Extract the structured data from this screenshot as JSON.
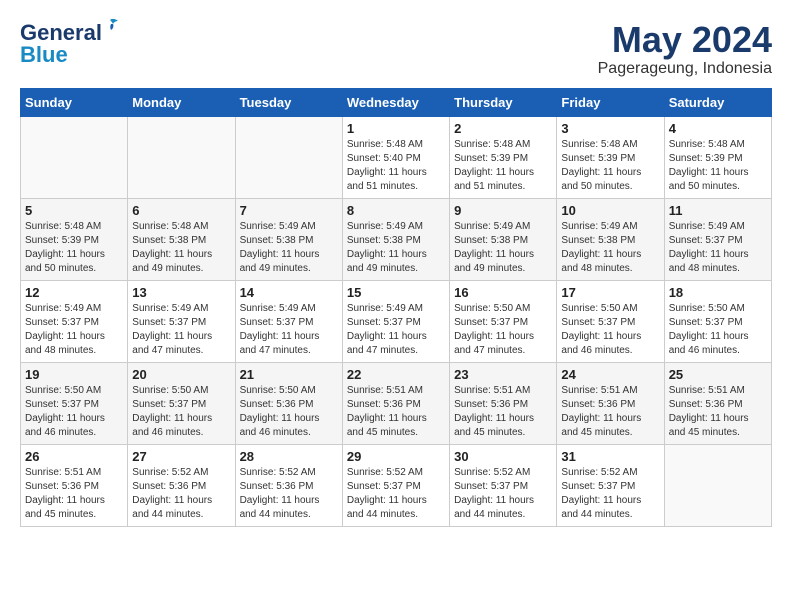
{
  "logo": {
    "text_general": "General",
    "text_blue": "Blue"
  },
  "title": {
    "month_year": "May 2024",
    "location": "Pagerageung, Indonesia"
  },
  "days_header": [
    "Sunday",
    "Monday",
    "Tuesday",
    "Wednesday",
    "Thursday",
    "Friday",
    "Saturday"
  ],
  "weeks": [
    {
      "days": [
        {
          "num": "",
          "info": ""
        },
        {
          "num": "",
          "info": ""
        },
        {
          "num": "",
          "info": ""
        },
        {
          "num": "1",
          "info": "Sunrise: 5:48 AM\nSunset: 5:40 PM\nDaylight: 11 hours\nand 51 minutes."
        },
        {
          "num": "2",
          "info": "Sunrise: 5:48 AM\nSunset: 5:39 PM\nDaylight: 11 hours\nand 51 minutes."
        },
        {
          "num": "3",
          "info": "Sunrise: 5:48 AM\nSunset: 5:39 PM\nDaylight: 11 hours\nand 50 minutes."
        },
        {
          "num": "4",
          "info": "Sunrise: 5:48 AM\nSunset: 5:39 PM\nDaylight: 11 hours\nand 50 minutes."
        }
      ]
    },
    {
      "days": [
        {
          "num": "5",
          "info": "Sunrise: 5:48 AM\nSunset: 5:39 PM\nDaylight: 11 hours\nand 50 minutes."
        },
        {
          "num": "6",
          "info": "Sunrise: 5:48 AM\nSunset: 5:38 PM\nDaylight: 11 hours\nand 49 minutes."
        },
        {
          "num": "7",
          "info": "Sunrise: 5:49 AM\nSunset: 5:38 PM\nDaylight: 11 hours\nand 49 minutes."
        },
        {
          "num": "8",
          "info": "Sunrise: 5:49 AM\nSunset: 5:38 PM\nDaylight: 11 hours\nand 49 minutes."
        },
        {
          "num": "9",
          "info": "Sunrise: 5:49 AM\nSunset: 5:38 PM\nDaylight: 11 hours\nand 49 minutes."
        },
        {
          "num": "10",
          "info": "Sunrise: 5:49 AM\nSunset: 5:38 PM\nDaylight: 11 hours\nand 48 minutes."
        },
        {
          "num": "11",
          "info": "Sunrise: 5:49 AM\nSunset: 5:37 PM\nDaylight: 11 hours\nand 48 minutes."
        }
      ]
    },
    {
      "days": [
        {
          "num": "12",
          "info": "Sunrise: 5:49 AM\nSunset: 5:37 PM\nDaylight: 11 hours\nand 48 minutes."
        },
        {
          "num": "13",
          "info": "Sunrise: 5:49 AM\nSunset: 5:37 PM\nDaylight: 11 hours\nand 47 minutes."
        },
        {
          "num": "14",
          "info": "Sunrise: 5:49 AM\nSunset: 5:37 PM\nDaylight: 11 hours\nand 47 minutes."
        },
        {
          "num": "15",
          "info": "Sunrise: 5:49 AM\nSunset: 5:37 PM\nDaylight: 11 hours\nand 47 minutes."
        },
        {
          "num": "16",
          "info": "Sunrise: 5:50 AM\nSunset: 5:37 PM\nDaylight: 11 hours\nand 47 minutes."
        },
        {
          "num": "17",
          "info": "Sunrise: 5:50 AM\nSunset: 5:37 PM\nDaylight: 11 hours\nand 46 minutes."
        },
        {
          "num": "18",
          "info": "Sunrise: 5:50 AM\nSunset: 5:37 PM\nDaylight: 11 hours\nand 46 minutes."
        }
      ]
    },
    {
      "days": [
        {
          "num": "19",
          "info": "Sunrise: 5:50 AM\nSunset: 5:37 PM\nDaylight: 11 hours\nand 46 minutes."
        },
        {
          "num": "20",
          "info": "Sunrise: 5:50 AM\nSunset: 5:37 PM\nDaylight: 11 hours\nand 46 minutes."
        },
        {
          "num": "21",
          "info": "Sunrise: 5:50 AM\nSunset: 5:36 PM\nDaylight: 11 hours\nand 46 minutes."
        },
        {
          "num": "22",
          "info": "Sunrise: 5:51 AM\nSunset: 5:36 PM\nDaylight: 11 hours\nand 45 minutes."
        },
        {
          "num": "23",
          "info": "Sunrise: 5:51 AM\nSunset: 5:36 PM\nDaylight: 11 hours\nand 45 minutes."
        },
        {
          "num": "24",
          "info": "Sunrise: 5:51 AM\nSunset: 5:36 PM\nDaylight: 11 hours\nand 45 minutes."
        },
        {
          "num": "25",
          "info": "Sunrise: 5:51 AM\nSunset: 5:36 PM\nDaylight: 11 hours\nand 45 minutes."
        }
      ]
    },
    {
      "days": [
        {
          "num": "26",
          "info": "Sunrise: 5:51 AM\nSunset: 5:36 PM\nDaylight: 11 hours\nand 45 minutes."
        },
        {
          "num": "27",
          "info": "Sunrise: 5:52 AM\nSunset: 5:36 PM\nDaylight: 11 hours\nand 44 minutes."
        },
        {
          "num": "28",
          "info": "Sunrise: 5:52 AM\nSunset: 5:36 PM\nDaylight: 11 hours\nand 44 minutes."
        },
        {
          "num": "29",
          "info": "Sunrise: 5:52 AM\nSunset: 5:37 PM\nDaylight: 11 hours\nand 44 minutes."
        },
        {
          "num": "30",
          "info": "Sunrise: 5:52 AM\nSunset: 5:37 PM\nDaylight: 11 hours\nand 44 minutes."
        },
        {
          "num": "31",
          "info": "Sunrise: 5:52 AM\nSunset: 5:37 PM\nDaylight: 11 hours\nand 44 minutes."
        },
        {
          "num": "",
          "info": ""
        }
      ]
    }
  ]
}
